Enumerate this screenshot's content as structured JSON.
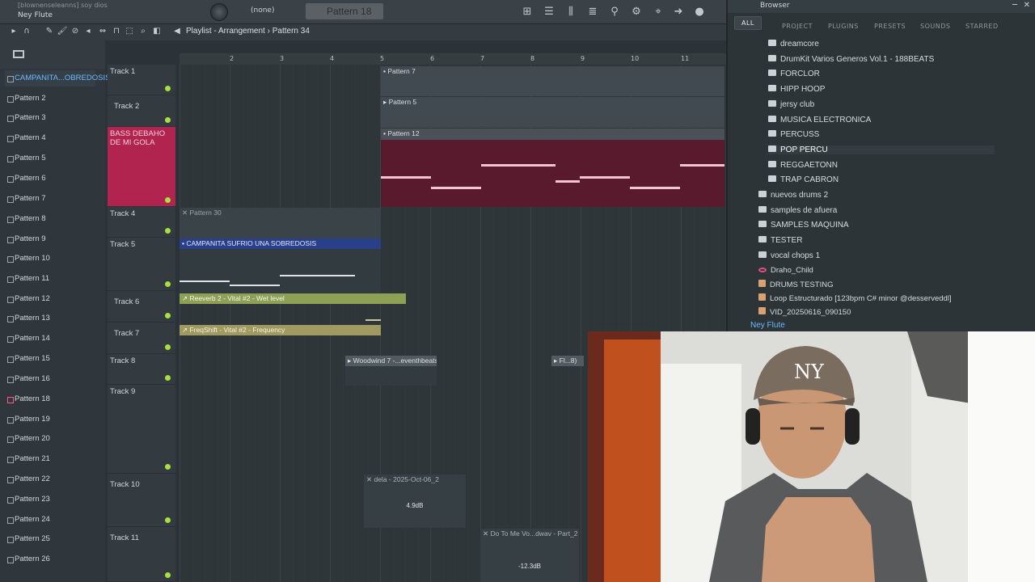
{
  "topbar": {
    "song": "[blownenseleanns] soy dios",
    "user": "Ney Flute",
    "channel": "(none)",
    "pattern": "Pattern 18"
  },
  "playlist": {
    "title": "Playlist - Arrangement",
    "separator": "›",
    "pattern": "Pattern 34",
    "ruler": [
      "2",
      "3",
      "4",
      "5",
      "6",
      "7",
      "8",
      "9",
      "10",
      "11"
    ]
  },
  "patterns": [
    "CAMPANITA...OBREDOSIS",
    "Pattern 2",
    "Pattern 3",
    "Pattern 4",
    "Pattern 5",
    "Pattern 6",
    "Pattern 7",
    "Pattern 8",
    "Pattern 9",
    "Pattern 10",
    "Pattern 11",
    "Pattern 12",
    "Pattern 13",
    "Pattern 14",
    "Pattern 15",
    "Pattern 16",
    "Pattern 18",
    "Pattern 19",
    "Pattern 20",
    "Pattern 21",
    "Pattern 22",
    "Pattern 23",
    "Pattern 24",
    "Pattern 25",
    "Pattern 26"
  ],
  "tracks": [
    "Track 1",
    "Track 2",
    "BASS DEBAHO DE MI GOLA",
    "Track 4",
    "Track 5",
    "Track 6",
    "Track 7",
    "Track 8",
    "Track 9",
    "Track 10",
    "Track 11"
  ],
  "clips": {
    "c1": "Pattern 7",
    "c2": "Pattern 5",
    "c3": "Pattern 12",
    "c4": "Pattern 30",
    "c5": "CAMPANITA SUFRIO UNA SOBREDOSIS",
    "c6": "Reeverb 2 - Vital #2 - Wet level",
    "c7": "FreqShift - Vital #2 - Frequency",
    "c8": "Woodwind 7 -...eventhbeats",
    "c9": "Fl...8)",
    "c10": "dela - 2025-Oct-06_2",
    "c10db": "4.9dB",
    "c11": "Do To Me Vo...dwav - Part_2",
    "c11db": "-12.3dB"
  },
  "browser": {
    "title": "Browser",
    "tabs": [
      "ALL",
      "PROJECT",
      "PLUGINS",
      "PRESETS",
      "SOUNDS",
      "STARRED"
    ],
    "folders": [
      "dreamcore",
      "DrumKit Varios Generos Vol.1 - 188BEATS",
      "FORCLOR",
      "HIPP HOOP",
      "jersy club",
      "MUSICA ELECTRONICA",
      "PERCUSS",
      "POP PERCU",
      "REGGAETONN",
      "TRAP CABRON"
    ],
    "subfolders": [
      "nuevos drums 2",
      "samples de afuera",
      "SAMPLES MAQUINA",
      "TESTER",
      "vocal chops 1"
    ],
    "files": [
      "Draho_Child",
      "DRUMS TESTING",
      "Loop Estructurado [123bpm C# minor @desserveddl]",
      "VID_20250616_090150"
    ],
    "footer": "Ney Flute"
  },
  "colors": {
    "accent": "#a8e040",
    "selected": "#6fb8ff",
    "bass": "#b0244f"
  },
  "icons": [
    "magnet-icon",
    "pencil-icon",
    "brush-icon",
    "delete-icon",
    "mute-icon",
    "slip-icon",
    "select-icon",
    "zoom-icon",
    "playback-icon",
    "close-icon"
  ]
}
